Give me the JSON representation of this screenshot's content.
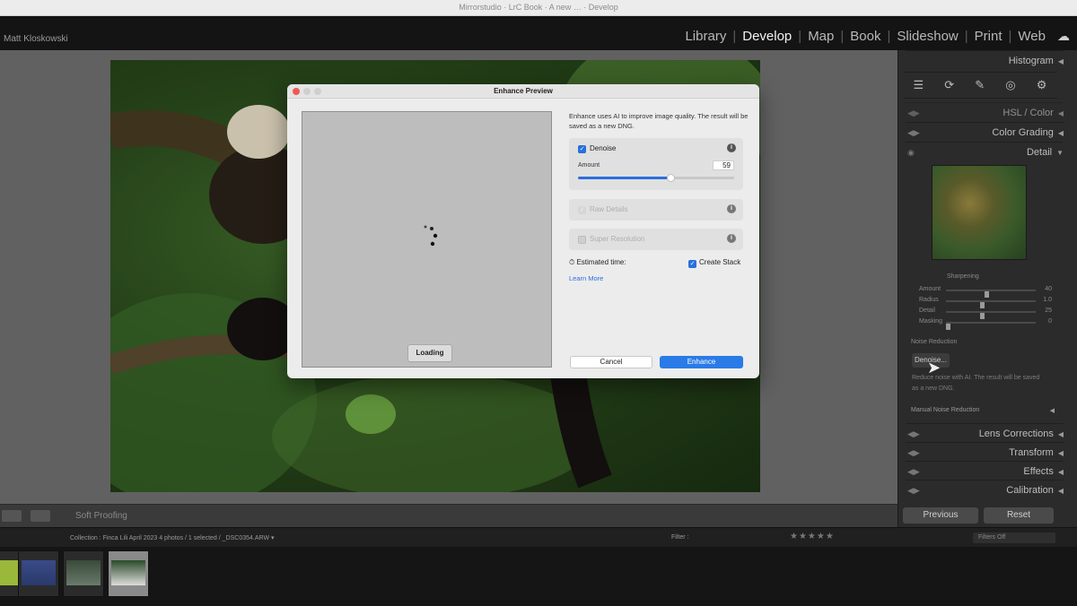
{
  "app": {
    "window_title": "Mirrorstudio · LrC Book · A new … · Develop",
    "user_name": "Matt Kloskowski"
  },
  "modules": [
    {
      "label": "Library",
      "active": false
    },
    {
      "label": "Develop",
      "active": true
    },
    {
      "label": "Map",
      "active": false
    },
    {
      "label": "Book",
      "active": false
    },
    {
      "label": "Slideshow",
      "active": false
    },
    {
      "label": "Print",
      "active": false
    },
    {
      "label": "Web",
      "active": false
    }
  ],
  "toolbar": {
    "soft_proofing": "Soft Proofing"
  },
  "right_panel": {
    "histogram": "Histogram",
    "hsl": "HSL / Color",
    "color_grading": "Color Grading",
    "detail": "Detail",
    "sharpening": {
      "title": "Sharpening",
      "rows": [
        {
          "label": "Amount",
          "value": "40",
          "level": 0.45
        },
        {
          "label": "Radius",
          "value": "1.0",
          "level": 0.4
        },
        {
          "label": "Detail",
          "value": "25",
          "level": 0.4
        },
        {
          "label": "Masking",
          "value": "0",
          "level": 0.0
        }
      ]
    },
    "noise_reduction": "Noise Reduction",
    "denoise_button": "Denoise...",
    "denoise_desc": "Reduce noise with AI. The result will be saved as a new DNG.",
    "manual_noise_reduction": "Manual Noise Reduction",
    "lens_corrections": "Lens Corrections",
    "transform": "Transform",
    "effects": "Effects",
    "calibration": "Calibration",
    "previous": "Previous",
    "reset": "Reset"
  },
  "filmbar": {
    "path": "Collection : Finca Lili April 2023     4 photos / 1 selected / _DSC0354.ARW ▾",
    "filter_label": "Filter :",
    "stars": "★★★★★",
    "filters_off": "Filters Off"
  },
  "dialog": {
    "title": "Enhance Preview",
    "loading": "Loading",
    "description": "Enhance uses AI to improve image quality. The result will be saved as a new DNG.",
    "denoise": {
      "label": "Denoise",
      "checked": true,
      "amount_label": "Amount",
      "amount_value": "59",
      "amount": 59
    },
    "raw_details": {
      "label": "Raw Details",
      "checked": true,
      "disabled": true
    },
    "super_resolution": {
      "label": "Super Resolution",
      "checked": false,
      "disabled": true
    },
    "estimated_time": "Estimated time:",
    "create_stack": {
      "label": "Create Stack",
      "checked": true
    },
    "learn_more": "Learn More",
    "cancel": "Cancel",
    "enhance": "Enhance"
  },
  "colors": {
    "accent": "#2a6fdb",
    "enhance_button": "#2a7be8"
  }
}
